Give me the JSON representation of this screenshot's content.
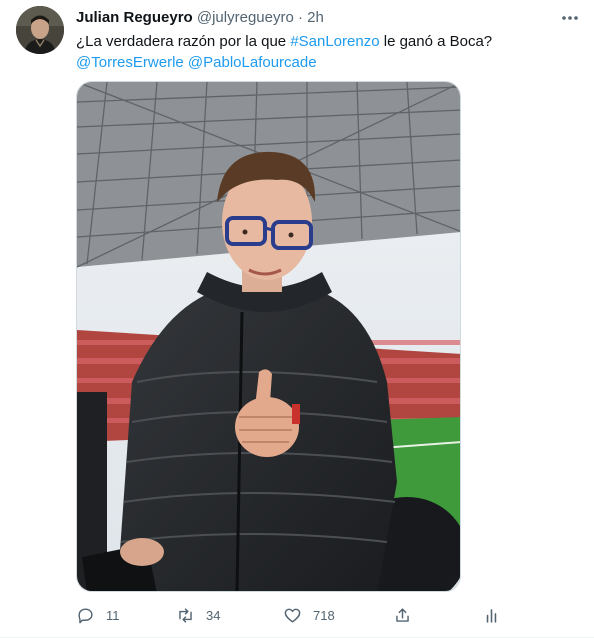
{
  "tweet": {
    "author_name": "Julian Regueyro",
    "author_handle": "@julyregueyro",
    "separator": "·",
    "time": "2h",
    "text_parts": {
      "before": "¿La verdadera razón por la que ",
      "hashtag": "#SanLorenzo",
      "after": " le ganó a Boca?",
      "mention1": "@TorresErwerle",
      "mention2": "@PabloLafourcade"
    },
    "actions": {
      "replies": "11",
      "retweets": "34",
      "likes": "718"
    },
    "icons": {
      "more": "more-horizontal-icon",
      "reply": "reply-icon",
      "retweet": "retweet-icon",
      "like": "heart-icon",
      "share": "share-icon",
      "analytics": "analytics-icon"
    },
    "colors": {
      "link": "#1d9bf0",
      "secondary_text": "#536471",
      "primary_text": "#0f1419"
    }
  }
}
